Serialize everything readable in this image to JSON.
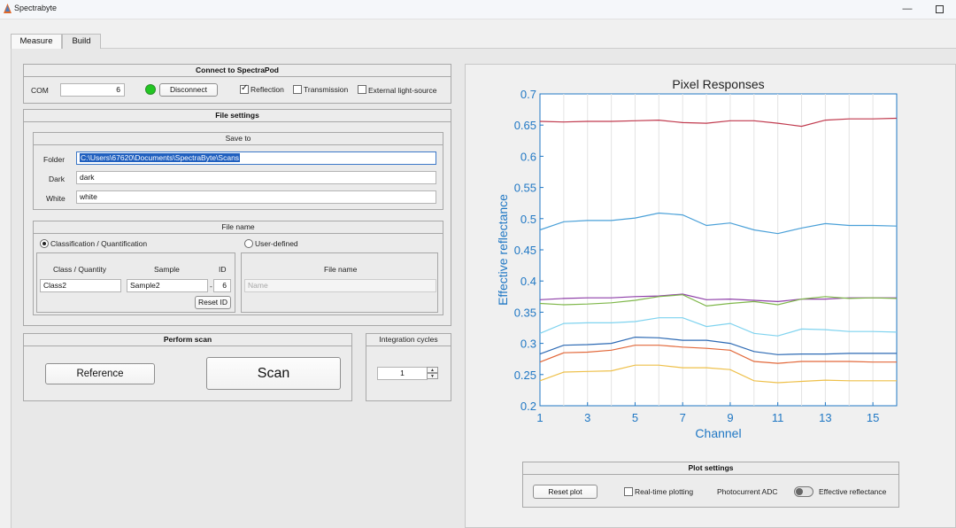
{
  "window": {
    "title": "Spectrabyte",
    "minimize_glyph": "—"
  },
  "tabs": [
    {
      "label": "Measure",
      "active": true
    },
    {
      "label": "Build",
      "active": false
    }
  ],
  "connect": {
    "header": "Connect to SpectraPod",
    "com_label": "COM",
    "com_value": "6",
    "status_color": "#22c622",
    "disconnect_label": "Disconnect",
    "reflection_label": "Reflection",
    "reflection_checked": true,
    "transmission_label": "Transmission",
    "transmission_checked": false,
    "external_label": "External light-source",
    "external_checked": false
  },
  "file_settings": {
    "header": "File settings",
    "save_to": {
      "header": "Save to",
      "folder_label": "Folder",
      "folder_value": "C:\\Users\\67620\\Documents\\SpectraByte\\Scans",
      "dark_label": "Dark",
      "dark_value": "dark",
      "white_label": "White",
      "white_value": "white"
    },
    "file_name": {
      "header": "File name",
      "classification_label": "Classification / Quantification",
      "classification_selected": true,
      "user_defined_label": "User-defined",
      "user_defined_selected": false,
      "class_header": "Class / Quantity",
      "sample_header": "Sample",
      "id_header": "ID",
      "class_value": "Class2",
      "sample_value": "Sample2",
      "dash": "-",
      "id_value": "6",
      "reset_id_label": "Reset ID",
      "file_name_header": "File name",
      "file_name_placeholder": "Name"
    }
  },
  "scan": {
    "header": "Perform scan",
    "reference_label": "Reference",
    "scan_label": "Scan"
  },
  "integration": {
    "header": "Integration cycles",
    "value": "1",
    "up_glyph": "▲",
    "down_glyph": "▼"
  },
  "plot_settings": {
    "header": "Plot settings",
    "reset_label": "Reset plot",
    "realtime_label": "Real-time plotting",
    "realtime_checked": false,
    "photocurrent_label": "Photocurrent ADC",
    "effective_label": "Effective reflectance"
  },
  "chart_data": {
    "type": "line",
    "title": "Pixel Responses",
    "xlabel": "Channel",
    "ylabel": "Effective reflectance",
    "xlim": [
      1,
      16
    ],
    "ylim": [
      0.2,
      0.7
    ],
    "xticks": [
      1,
      3,
      5,
      7,
      9,
      11,
      13,
      15
    ],
    "yticks": [
      0.2,
      0.25,
      0.3,
      0.35,
      0.4,
      0.45,
      0.5,
      0.55,
      0.6,
      0.65,
      0.7
    ],
    "grid": "vertical",
    "axis_color": "#1f77c4",
    "x": [
      1,
      2,
      3,
      4,
      5,
      6,
      7,
      8,
      9,
      10,
      11,
      12,
      13,
      14,
      15,
      16
    ],
    "series": [
      {
        "color": "#c0394d",
        "values": [
          0.656,
          0.655,
          0.656,
          0.656,
          0.657,
          0.658,
          0.654,
          0.653,
          0.657,
          0.657,
          0.653,
          0.648,
          0.658,
          0.66,
          0.66,
          0.661
        ]
      },
      {
        "color": "#4aa0d8",
        "values": [
          0.482,
          0.495,
          0.497,
          0.497,
          0.501,
          0.509,
          0.506,
          0.489,
          0.493,
          0.482,
          0.476,
          0.485,
          0.492,
          0.489,
          0.489,
          0.488
        ]
      },
      {
        "color": "#8e3fa8",
        "values": [
          0.37,
          0.372,
          0.373,
          0.373,
          0.375,
          0.376,
          0.379,
          0.37,
          0.371,
          0.369,
          0.367,
          0.371,
          0.371,
          0.373,
          0.373,
          0.373
        ]
      },
      {
        "color": "#7fb74a",
        "values": [
          0.364,
          0.362,
          0.363,
          0.365,
          0.369,
          0.375,
          0.378,
          0.36,
          0.364,
          0.367,
          0.362,
          0.371,
          0.375,
          0.372,
          0.373,
          0.372
        ]
      },
      {
        "color": "#7fd3ef",
        "values": [
          0.316,
          0.332,
          0.333,
          0.333,
          0.335,
          0.341,
          0.341,
          0.327,
          0.332,
          0.316,
          0.312,
          0.323,
          0.322,
          0.319,
          0.319,
          0.318
        ]
      },
      {
        "color": "#2d6ab4",
        "values": [
          0.283,
          0.297,
          0.298,
          0.3,
          0.31,
          0.309,
          0.305,
          0.305,
          0.3,
          0.287,
          0.282,
          0.283,
          0.283,
          0.284,
          0.284,
          0.284
        ]
      },
      {
        "color": "#e2683a",
        "values": [
          0.27,
          0.285,
          0.286,
          0.289,
          0.297,
          0.297,
          0.294,
          0.292,
          0.289,
          0.271,
          0.268,
          0.271,
          0.271,
          0.271,
          0.27,
          0.27
        ]
      },
      {
        "color": "#eec04a",
        "values": [
          0.24,
          0.254,
          0.255,
          0.256,
          0.265,
          0.265,
          0.261,
          0.261,
          0.258,
          0.24,
          0.237,
          0.239,
          0.241,
          0.24,
          0.24,
          0.24
        ]
      }
    ]
  }
}
